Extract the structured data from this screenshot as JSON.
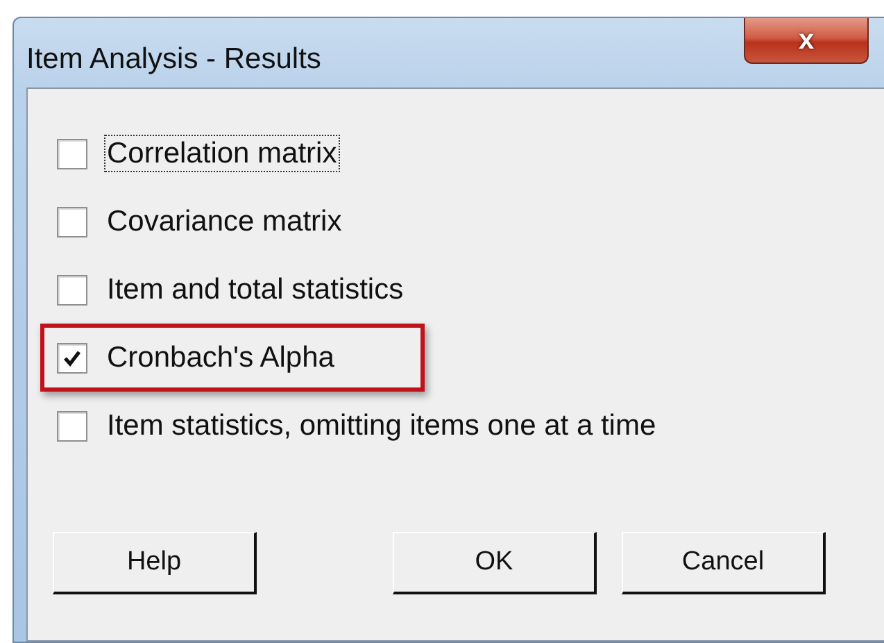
{
  "window": {
    "title": "Item Analysis - Results",
    "close_label": "x"
  },
  "options": [
    {
      "label": "Correlation matrix",
      "checked": false,
      "focused": true,
      "highlighted": false
    },
    {
      "label": "Covariance matrix",
      "checked": false,
      "focused": false,
      "highlighted": false
    },
    {
      "label": "Item and total statistics",
      "checked": false,
      "focused": false,
      "highlighted": false
    },
    {
      "label": "Cronbach's Alpha",
      "checked": true,
      "focused": false,
      "highlighted": true
    },
    {
      "label": "Item statistics, omitting items one at a time",
      "checked": false,
      "focused": false,
      "highlighted": false
    }
  ],
  "buttons": [
    {
      "label": "Help",
      "kind": "left"
    },
    {
      "label": "OK",
      "kind": "right"
    },
    {
      "label": "Cancel",
      "kind": "right"
    }
  ]
}
